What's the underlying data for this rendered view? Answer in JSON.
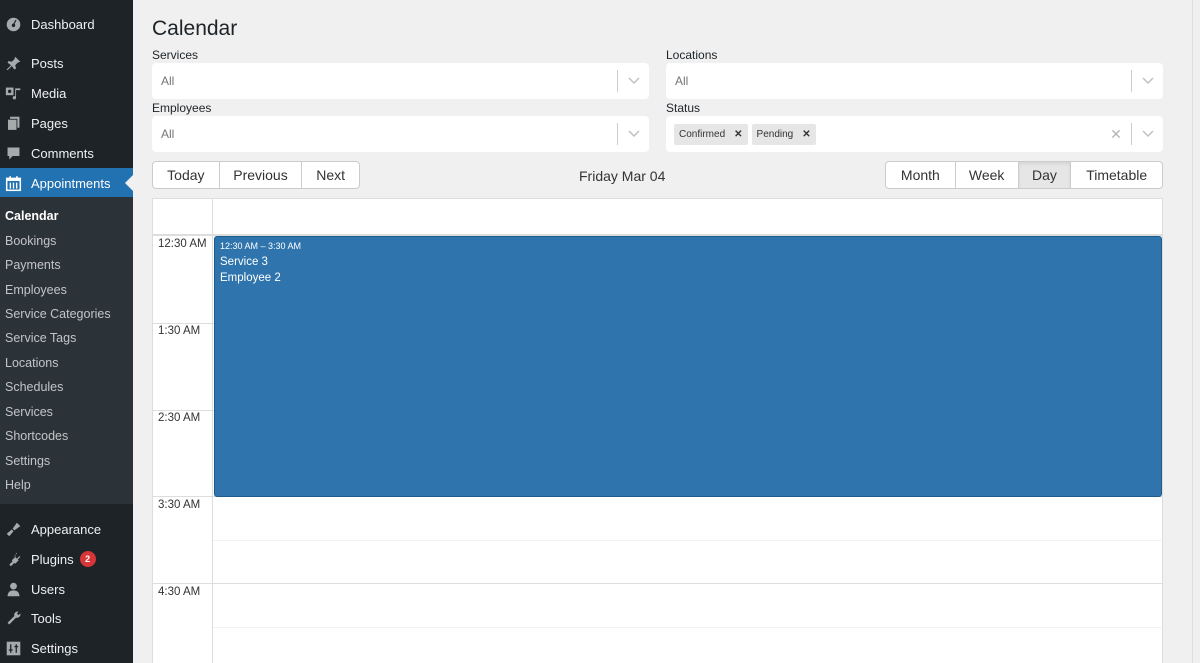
{
  "sidebar": {
    "top_items": [
      {
        "label": "Dashboard",
        "icon": "dashboard-icon"
      },
      {
        "label": "Posts",
        "icon": "pin-icon"
      },
      {
        "label": "Media",
        "icon": "media-icon"
      },
      {
        "label": "Pages",
        "icon": "pages-icon"
      },
      {
        "label": "Comments",
        "icon": "comment-icon"
      },
      {
        "label": "Appointments",
        "icon": "calendar-icon",
        "active": true
      }
    ],
    "submenu": [
      "Calendar",
      "Bookings",
      "Payments",
      "Employees",
      "Service Categories",
      "Service Tags",
      "Locations",
      "Schedules",
      "Services",
      "Shortcodes",
      "Settings",
      "Help"
    ],
    "bottom_items": [
      {
        "label": "Appearance",
        "icon": "brush-icon"
      },
      {
        "label": "Plugins",
        "icon": "plugin-icon",
        "badge": "2"
      },
      {
        "label": "Users",
        "icon": "user-icon"
      },
      {
        "label": "Tools",
        "icon": "wrench-icon"
      },
      {
        "label": "Settings",
        "icon": "settings-icon"
      }
    ]
  },
  "page": {
    "title": "Calendar"
  },
  "filters": {
    "services": {
      "label": "Services",
      "value": "All"
    },
    "locations": {
      "label": "Locations",
      "value": "All"
    },
    "employees": {
      "label": "Employees",
      "value": "All"
    },
    "status": {
      "label": "Status",
      "chips": [
        "Confirmed",
        "Pending"
      ]
    }
  },
  "toolbar": {
    "nav": [
      "Today",
      "Previous",
      "Next"
    ],
    "date_title": "Friday Mar 04",
    "views": [
      "Month",
      "Week",
      "Day",
      "Timetable"
    ],
    "active_view": "Day"
  },
  "calendar": {
    "time_labels": [
      "12:30 AM",
      "1:30 AM",
      "2:30 AM",
      "3:30 AM",
      "4:30 AM"
    ],
    "events": [
      {
        "time": "12:30 AM – 3:30 AM",
        "service": "Service 3",
        "employee": "Employee 2",
        "color": "#2f74ad"
      }
    ]
  },
  "colors": {
    "admin_bar": "#1d2327",
    "accent": "#2271b1",
    "event": "#2f74ad"
  }
}
